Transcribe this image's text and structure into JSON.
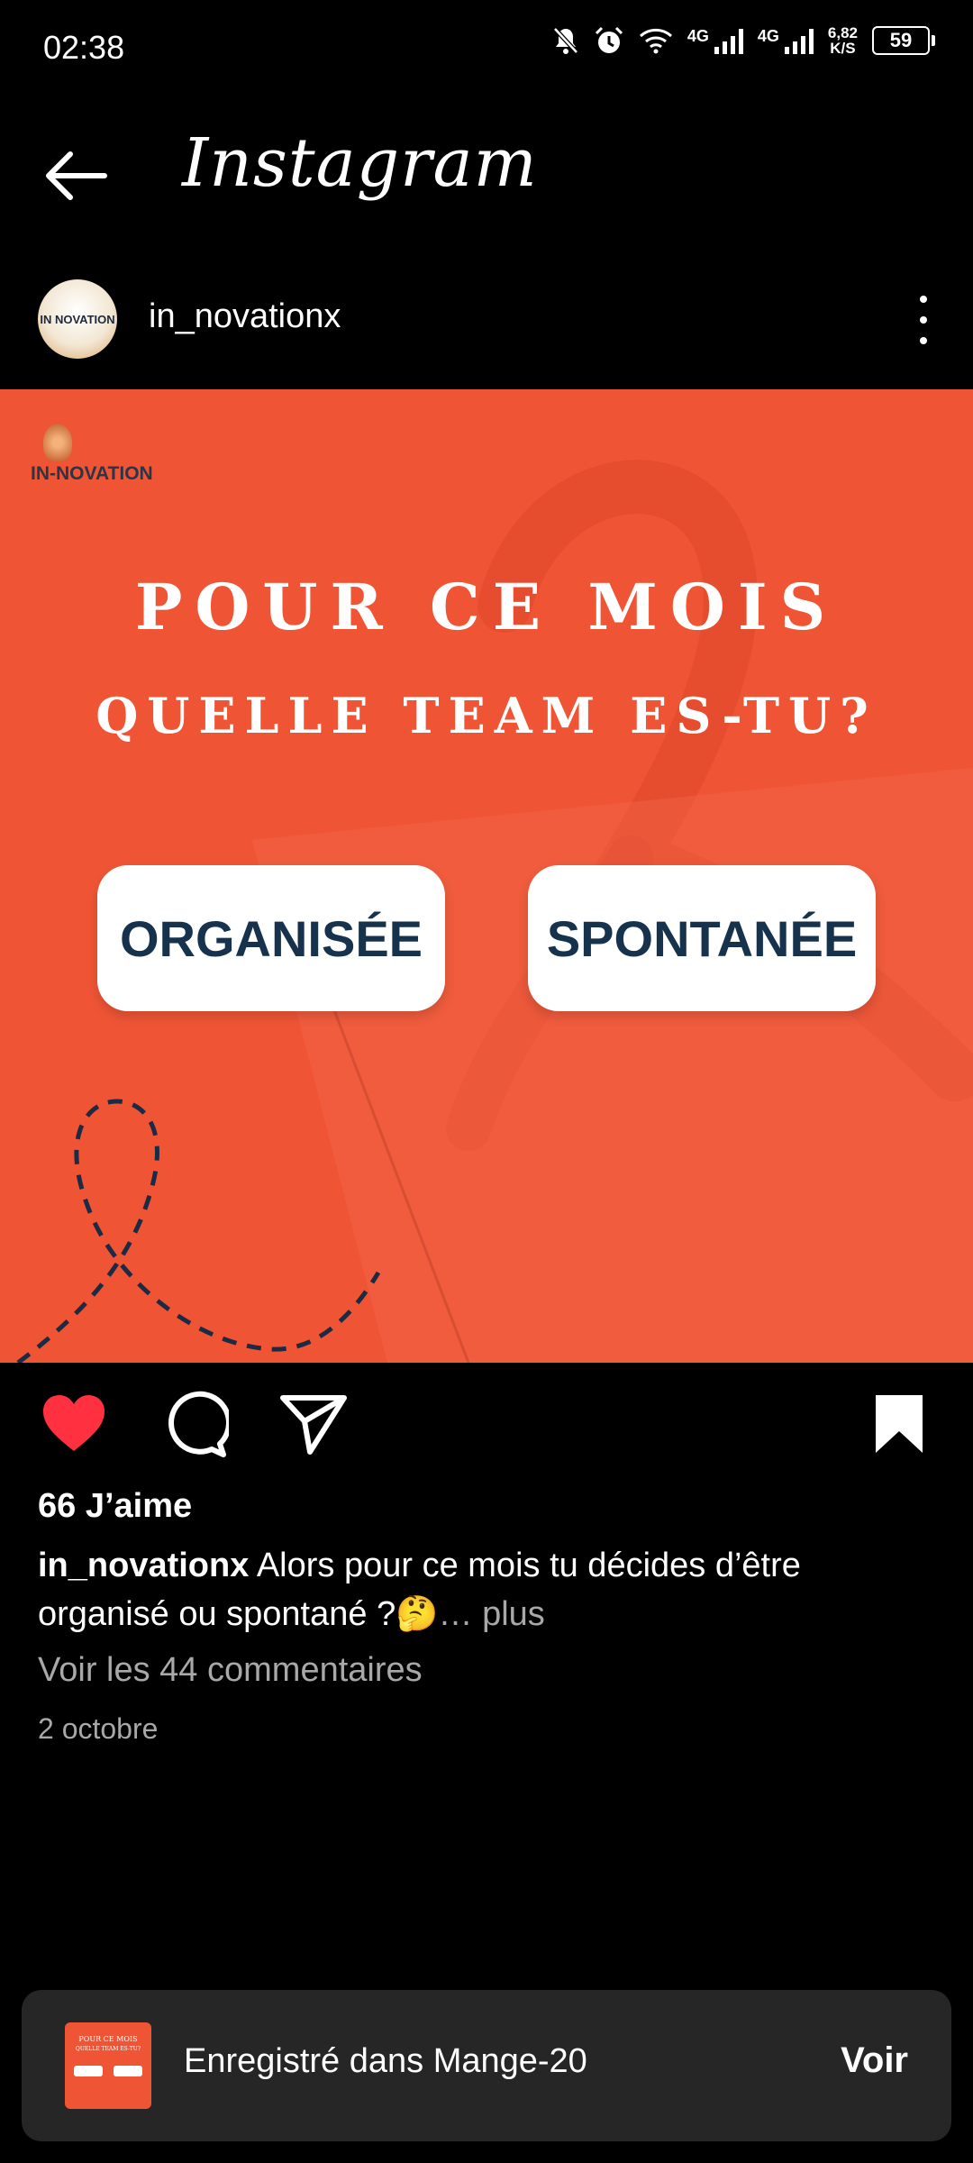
{
  "status_bar": {
    "time": "02:38",
    "net1": "4G",
    "net2": "4G",
    "speed_value": "6,82",
    "speed_unit": "K/S",
    "battery": "59",
    "icons": [
      "mute-bell-icon",
      "alarm-icon",
      "wifi-icon",
      "signal-icon",
      "signal-icon",
      "battery-icon"
    ]
  },
  "header": {
    "app_title": "Instagram",
    "back_icon": "arrow-left-icon"
  },
  "post": {
    "username": "in_novationx",
    "avatar_text": "IN NOVATION",
    "image": {
      "brand": "IN-NOVATION",
      "headline_1": "POUR CE MOIS",
      "headline_2": "QUELLE TEAM ES-TU?",
      "choice_1": "ORGANISÉE",
      "choice_2": "SPONTANÉE",
      "bg_color": "#ef5535"
    },
    "likes": "66 J’aime",
    "caption_user": "in_novationx",
    "caption_text": " Alors pour ce mois tu décides d’être organisé ou spontané ?🤔",
    "caption_more": "… plus",
    "view_comments": "Voir les 44 commentaires",
    "date": "2 octobre",
    "liked": true,
    "like_color": "#ff3040"
  },
  "toast": {
    "thumb_line_1": "POUR CE MOIS",
    "thumb_line_2": "QUELLE TEAM ES-TU?",
    "text": "Enregistré dans Mange-20",
    "action": "Voir"
  }
}
